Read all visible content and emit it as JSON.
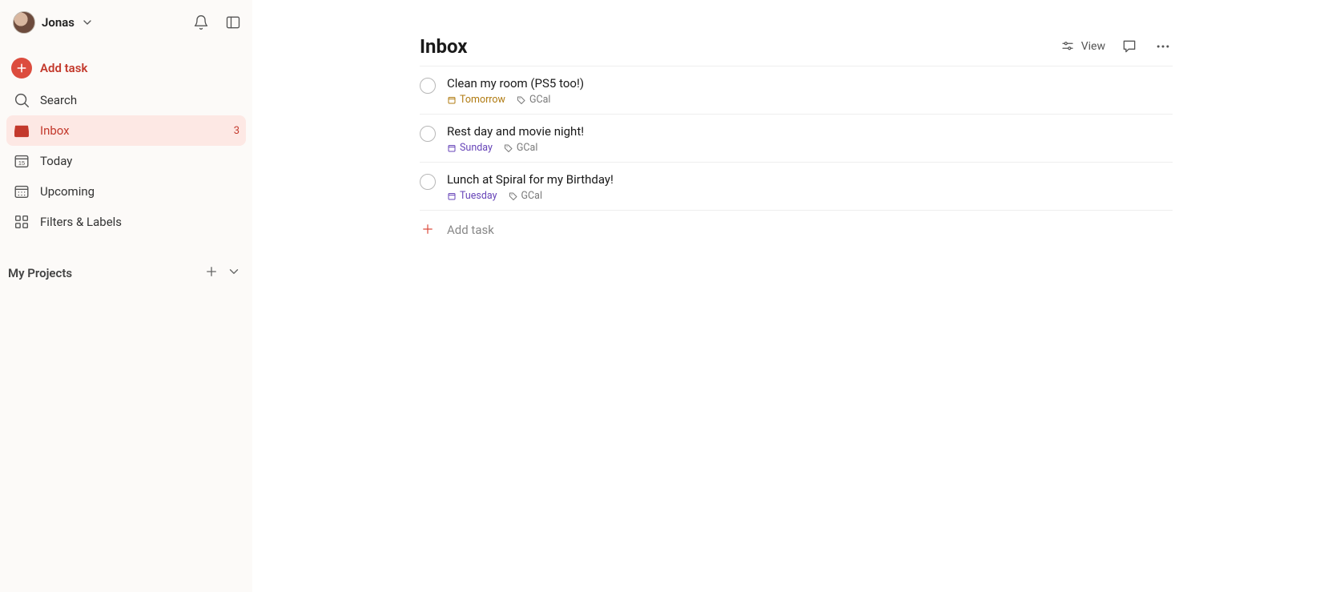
{
  "user": {
    "name": "Jonas"
  },
  "sidebar": {
    "add_task_label": "Add task",
    "nav": {
      "search": "Search",
      "inbox": "Inbox",
      "inbox_count": "3",
      "today": "Today",
      "upcoming": "Upcoming",
      "filters": "Filters & Labels"
    },
    "projects_header": "My Projects"
  },
  "page": {
    "title": "Inbox",
    "view_label": "View",
    "add_task_label": "Add task"
  },
  "tasks": [
    {
      "title": "Clean my room (PS5 too!)",
      "date": "Tomorrow",
      "date_style": "date-tomorrow",
      "label": "GCal"
    },
    {
      "title": "Rest day and movie night!",
      "date": "Sunday",
      "date_style": "date-purple",
      "label": "GCal"
    },
    {
      "title": "Lunch at Spiral for my Birthday!",
      "date": "Tuesday",
      "date_style": "date-purple",
      "label": "GCal"
    }
  ],
  "colors": {
    "accent": "#dc4c3e",
    "sidebar_bg": "#fcfaf8",
    "active_bg": "#fde8e4",
    "date_tomorrow": "#b07b12",
    "date_purple": "#6745b8",
    "label_grey": "#7a7a7a"
  }
}
